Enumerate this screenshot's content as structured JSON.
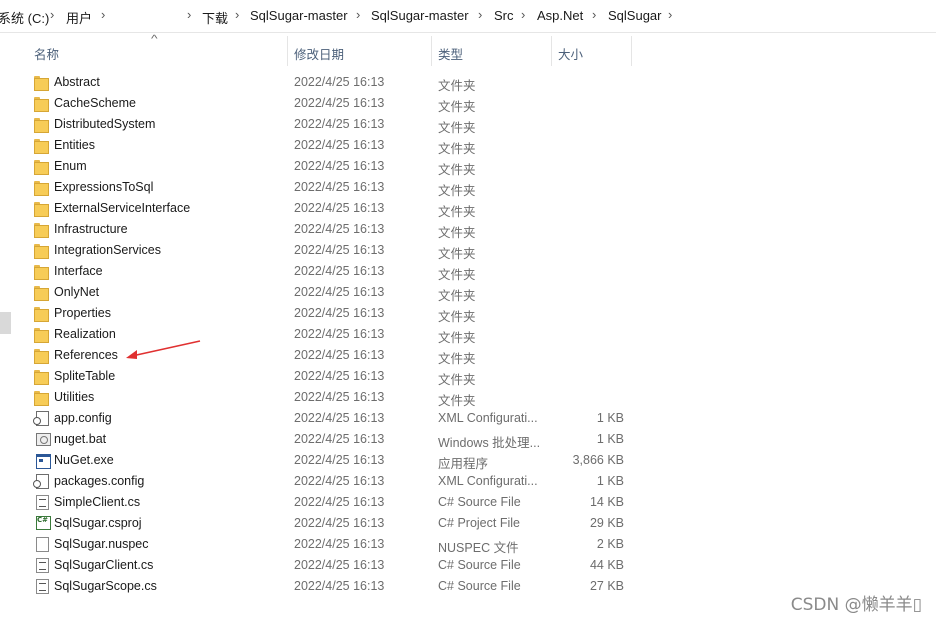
{
  "breadcrumb": {
    "items": [
      "系统 (C:)",
      "用户",
      "下载",
      "SqlSugar-master",
      "SqlSugar-master",
      "Src",
      "Asp.Net",
      "SqlSugar"
    ],
    "separator": "›"
  },
  "columns": {
    "name": "名称",
    "modified": "修改日期",
    "type": "类型",
    "size": "大小"
  },
  "rows": [
    {
      "name": "Abstract",
      "date": "2022/4/25 16:13",
      "type": "文件夹",
      "size": "",
      "icon": "folder-icon"
    },
    {
      "name": "CacheScheme",
      "date": "2022/4/25 16:13",
      "type": "文件夹",
      "size": "",
      "icon": "folder-icon"
    },
    {
      "name": "DistributedSystem",
      "date": "2022/4/25 16:13",
      "type": "文件夹",
      "size": "",
      "icon": "folder-icon"
    },
    {
      "name": "Entities",
      "date": "2022/4/25 16:13",
      "type": "文件夹",
      "size": "",
      "icon": "folder-icon"
    },
    {
      "name": "Enum",
      "date": "2022/4/25 16:13",
      "type": "文件夹",
      "size": "",
      "icon": "folder-icon"
    },
    {
      "name": "ExpressionsToSql",
      "date": "2022/4/25 16:13",
      "type": "文件夹",
      "size": "",
      "icon": "folder-icon"
    },
    {
      "name": "ExternalServiceInterface",
      "date": "2022/4/25 16:13",
      "type": "文件夹",
      "size": "",
      "icon": "folder-icon"
    },
    {
      "name": "Infrastructure",
      "date": "2022/4/25 16:13",
      "type": "文件夹",
      "size": "",
      "icon": "folder-icon"
    },
    {
      "name": "IntegrationServices",
      "date": "2022/4/25 16:13",
      "type": "文件夹",
      "size": "",
      "icon": "folder-icon"
    },
    {
      "name": "Interface",
      "date": "2022/4/25 16:13",
      "type": "文件夹",
      "size": "",
      "icon": "folder-icon"
    },
    {
      "name": "OnlyNet",
      "date": "2022/4/25 16:13",
      "type": "文件夹",
      "size": "",
      "icon": "folder-icon"
    },
    {
      "name": "Properties",
      "date": "2022/4/25 16:13",
      "type": "文件夹",
      "size": "",
      "icon": "folder-icon"
    },
    {
      "name": "Realization",
      "date": "2022/4/25 16:13",
      "type": "文件夹",
      "size": "",
      "icon": "folder-icon"
    },
    {
      "name": "References",
      "date": "2022/4/25 16:13",
      "type": "文件夹",
      "size": "",
      "icon": "folder-icon"
    },
    {
      "name": "SpliteTable",
      "date": "2022/4/25 16:13",
      "type": "文件夹",
      "size": "",
      "icon": "folder-icon"
    },
    {
      "name": "Utilities",
      "date": "2022/4/25 16:13",
      "type": "文件夹",
      "size": "",
      "icon": "folder-icon"
    },
    {
      "name": "app.config",
      "date": "2022/4/25 16:13",
      "type": "XML Configurati...",
      "size": "1 KB",
      "icon": "config-file-icon"
    },
    {
      "name": "nuget.bat",
      "date": "2022/4/25 16:13",
      "type": "Windows 批处理...",
      "size": "1 KB",
      "icon": "batch-file-icon"
    },
    {
      "name": "NuGet.exe",
      "date": "2022/4/25 16:13",
      "type": "应用程序",
      "size": "3,866 KB",
      "icon": "exe-file-icon"
    },
    {
      "name": "packages.config",
      "date": "2022/4/25 16:13",
      "type": "XML Configurati...",
      "size": "1 KB",
      "icon": "config-file-icon"
    },
    {
      "name": "SimpleClient.cs",
      "date": "2022/4/25 16:13",
      "type": "C# Source File",
      "size": "14 KB",
      "icon": "cs-file-icon"
    },
    {
      "name": "SqlSugar.csproj",
      "date": "2022/4/25 16:13",
      "type": "C# Project File",
      "size": "29 KB",
      "icon": "csproj-file-icon"
    },
    {
      "name": "SqlSugar.nuspec",
      "date": "2022/4/25 16:13",
      "type": "NUSPEC 文件",
      "size": "2 KB",
      "icon": "blank-file-icon"
    },
    {
      "name": "SqlSugarClient.cs",
      "date": "2022/4/25 16:13",
      "type": "C# Source File",
      "size": "44 KB",
      "icon": "cs-file-icon"
    },
    {
      "name": "SqlSugarScope.cs",
      "date": "2022/4/25 16:13",
      "type": "C# Source File",
      "size": "27 KB",
      "icon": "cs-file-icon"
    }
  ],
  "watermark": "CSDN @懒羊羊▯",
  "colors": {
    "folder": "#f7cc57",
    "arrow": "#e03030",
    "header_text": "#4c607a"
  }
}
